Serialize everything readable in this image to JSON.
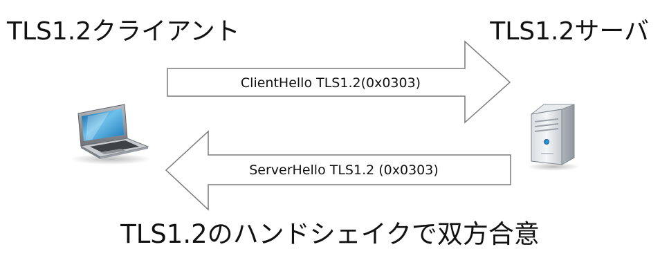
{
  "client": {
    "title": "TLS1.2クライアント",
    "device": "laptop-icon"
  },
  "server": {
    "title": "TLS1.2サーバ",
    "device": "server-tower-icon"
  },
  "messages": {
    "client_hello": "ClientHello TLS1.2(0x0303)",
    "server_hello": "ServerHello TLS1.2 (0x0303)"
  },
  "caption": "TLS1.2のハンドシェイクで双方合意",
  "colors": {
    "arrow_fill": "#ffffff",
    "arrow_stroke": "#7a7a7a",
    "text": "#111111"
  }
}
